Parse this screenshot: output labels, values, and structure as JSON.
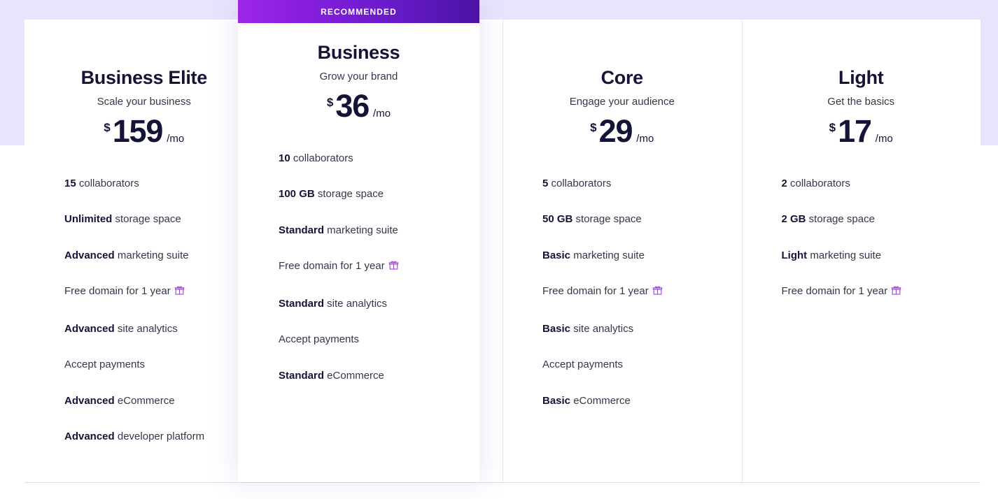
{
  "colors": {
    "page_background": "#ffffff",
    "band_background": "#e7e5fd",
    "card_background": "#ffffff",
    "badge_gradient_start": "#9d27e8",
    "badge_gradient_end": "#4a13a5",
    "heading_text": "#131436",
    "body_text": "#33374a",
    "divider": "#e6e6ec",
    "gift_icon": "#a440e0"
  },
  "badge": {
    "label": "RECOMMENDED"
  },
  "icons": {
    "gift": "gift-icon"
  },
  "plans": [
    {
      "name": "Business Elite",
      "tagline": "Scale your business",
      "currency": "$",
      "price": "159",
      "period": "/mo",
      "recommended": false,
      "features": [
        {
          "emph": "15",
          "rest": " collaborators",
          "gift": false
        },
        {
          "emph": "Unlimited",
          "rest": " storage space",
          "gift": false
        },
        {
          "emph": "Advanced",
          "rest": " marketing suite",
          "gift": false
        },
        {
          "emph": "",
          "rest": "Free domain for 1 year",
          "gift": true
        },
        {
          "emph": "Advanced",
          "rest": " site analytics",
          "gift": false
        },
        {
          "emph": "",
          "rest": "Accept payments",
          "gift": false
        },
        {
          "emph": "Advanced",
          "rest": " eCommerce",
          "gift": false
        },
        {
          "emph": "Advanced",
          "rest": " developer platform",
          "gift": false
        }
      ]
    },
    {
      "name": "Business",
      "tagline": "Grow your brand",
      "currency": "$",
      "price": "36",
      "period": "/mo",
      "recommended": true,
      "features": [
        {
          "emph": "10",
          "rest": " collaborators",
          "gift": false
        },
        {
          "emph": "100 GB",
          "rest": " storage space",
          "gift": false
        },
        {
          "emph": "Standard",
          "rest": " marketing suite",
          "gift": false
        },
        {
          "emph": "",
          "rest": "Free domain for 1 year",
          "gift": true
        },
        {
          "emph": "Standard",
          "rest": " site analytics",
          "gift": false
        },
        {
          "emph": "",
          "rest": "Accept payments",
          "gift": false
        },
        {
          "emph": "Standard",
          "rest": " eCommerce",
          "gift": false
        }
      ]
    },
    {
      "name": "Core",
      "tagline": "Engage your audience",
      "currency": "$",
      "price": "29",
      "period": "/mo",
      "recommended": false,
      "features": [
        {
          "emph": "5",
          "rest": " collaborators",
          "gift": false
        },
        {
          "emph": "50 GB",
          "rest": " storage space",
          "gift": false
        },
        {
          "emph": "Basic",
          "rest": " marketing suite",
          "gift": false
        },
        {
          "emph": "",
          "rest": "Free domain for 1 year",
          "gift": true
        },
        {
          "emph": "Basic",
          "rest": " site analytics",
          "gift": false
        },
        {
          "emph": "",
          "rest": "Accept payments",
          "gift": false
        },
        {
          "emph": "Basic",
          "rest": " eCommerce",
          "gift": false
        }
      ]
    },
    {
      "name": "Light",
      "tagline": "Get the basics",
      "currency": "$",
      "price": "17",
      "period": "/mo",
      "recommended": false,
      "features": [
        {
          "emph": "2",
          "rest": " collaborators",
          "gift": false
        },
        {
          "emph": "2 GB",
          "rest": " storage space",
          "gift": false
        },
        {
          "emph": "Light",
          "rest": " marketing suite",
          "gift": false
        },
        {
          "emph": "",
          "rest": "Free domain for 1 year",
          "gift": true
        }
      ]
    }
  ]
}
